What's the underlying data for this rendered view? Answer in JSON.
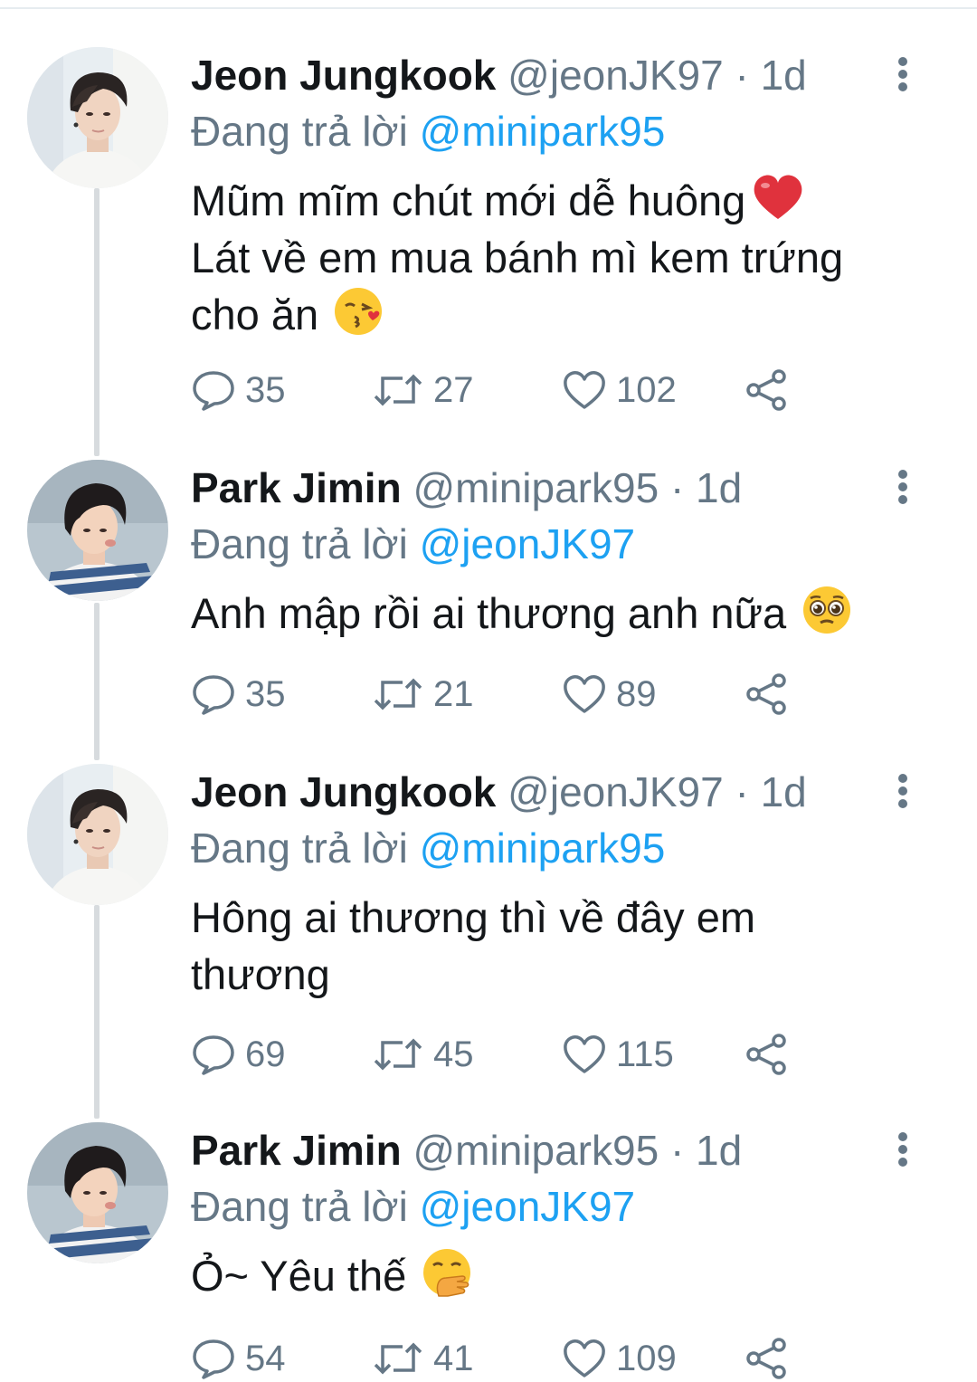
{
  "colors": {
    "name": "#14171a",
    "muted": "#657786",
    "mention": "#1da1f2",
    "thread_line": "#d7dbde"
  },
  "tweets": [
    {
      "name": "Jeon Jungkook",
      "handle": "@jeonJK97",
      "separator": "·",
      "time": "1d",
      "reply_prefix": "Đang trả lời",
      "reply_mention": "@minipark95",
      "text_lines": [
        "Mũm mĩm chút mới dễ huông",
        "Lát về em mua bánh mì kem trứng",
        "cho ăn"
      ],
      "emojis": [
        "red-heart-emoji",
        "face-blowing-kiss-emoji"
      ],
      "replies": "35",
      "retweets": "27",
      "likes": "102",
      "avatar": "jungkook-avatar"
    },
    {
      "name": "Park Jimin",
      "handle": "@minipark95",
      "separator": "·",
      "time": "1d",
      "reply_prefix": "Đang trả lời",
      "reply_mention": "@jeonJK97",
      "text_lines": [
        "Anh mập rồi ai thương anh nữa"
      ],
      "emojis": [
        "pleading-face-emoji"
      ],
      "replies": "35",
      "retweets": "21",
      "likes": "89",
      "avatar": "jimin-avatar"
    },
    {
      "name": "Jeon Jungkook",
      "handle": "@jeonJK97",
      "separator": "·",
      "time": "1d",
      "reply_prefix": "Đang trả lời",
      "reply_mention": "@minipark95",
      "text_lines": [
        "Hông ai thương thì về đây em",
        "thương"
      ],
      "emojis": [],
      "replies": "69",
      "retweets": "45",
      "likes": "115",
      "avatar": "jungkook-avatar"
    },
    {
      "name": "Park Jimin",
      "handle": "@minipark95",
      "separator": "·",
      "time": "1d",
      "reply_prefix": "Đang trả lời",
      "reply_mention": "@jeonJK97",
      "text_lines": [
        "Ỏ~ Yêu thế"
      ],
      "emojis": [
        "hand-over-mouth-emoji"
      ],
      "replies": "54",
      "retweets": "41",
      "likes": "109",
      "avatar": "jimin-avatar"
    }
  ]
}
